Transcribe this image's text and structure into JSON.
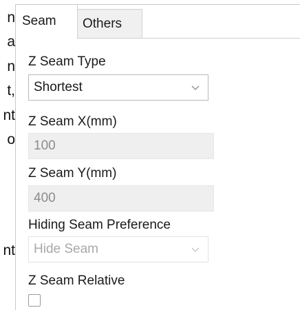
{
  "left_fragments": [
    "n",
    "a",
    "n",
    "t,",
    "nt",
    "o",
    "nt"
  ],
  "tabs": {
    "seam": "Seam",
    "others": "Others"
  },
  "fields": {
    "z_seam_type": {
      "label": "Z Seam Type",
      "value": "Shortest"
    },
    "z_seam_x": {
      "label": "Z Seam X(mm)",
      "value": "100"
    },
    "z_seam_y": {
      "label": "Z Seam Y(mm)",
      "value": "400"
    },
    "hiding_seam_preference": {
      "label": "Hiding Seam Preference",
      "value": "Hide Seam"
    },
    "z_seam_relative": {
      "label": "Z Seam Relative",
      "checked": false
    }
  }
}
